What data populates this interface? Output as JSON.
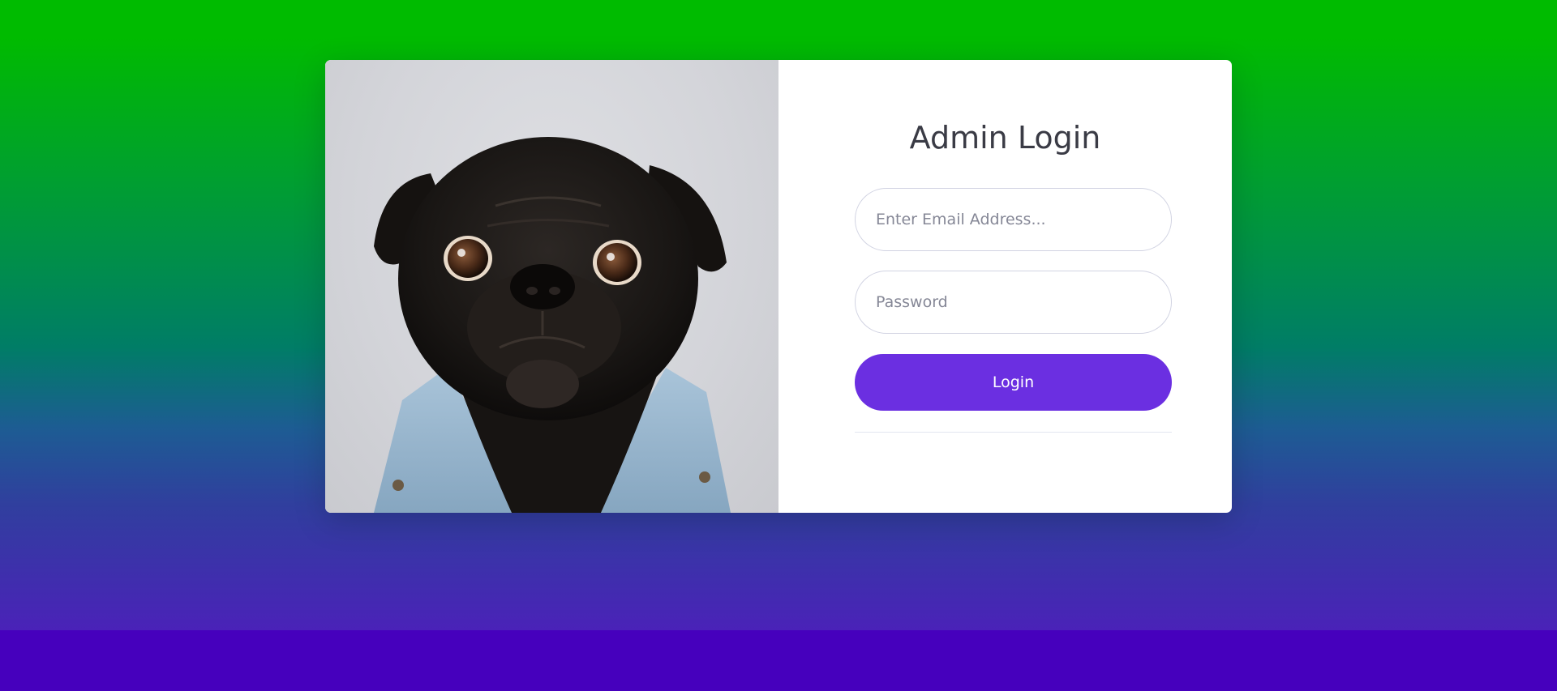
{
  "page": {
    "title": "Admin Login"
  },
  "form": {
    "email_placeholder": "Enter Email Address...",
    "password_placeholder": "Password",
    "login_label": "Login"
  },
  "colors": {
    "gradient_top": "#00bb00",
    "gradient_mid": "#007d66",
    "gradient_bottom": "#4600bd",
    "button": "#6b2fe1",
    "title_text": "#3a3b45"
  },
  "image": {
    "subject": "pug-in-denim-jacket"
  }
}
